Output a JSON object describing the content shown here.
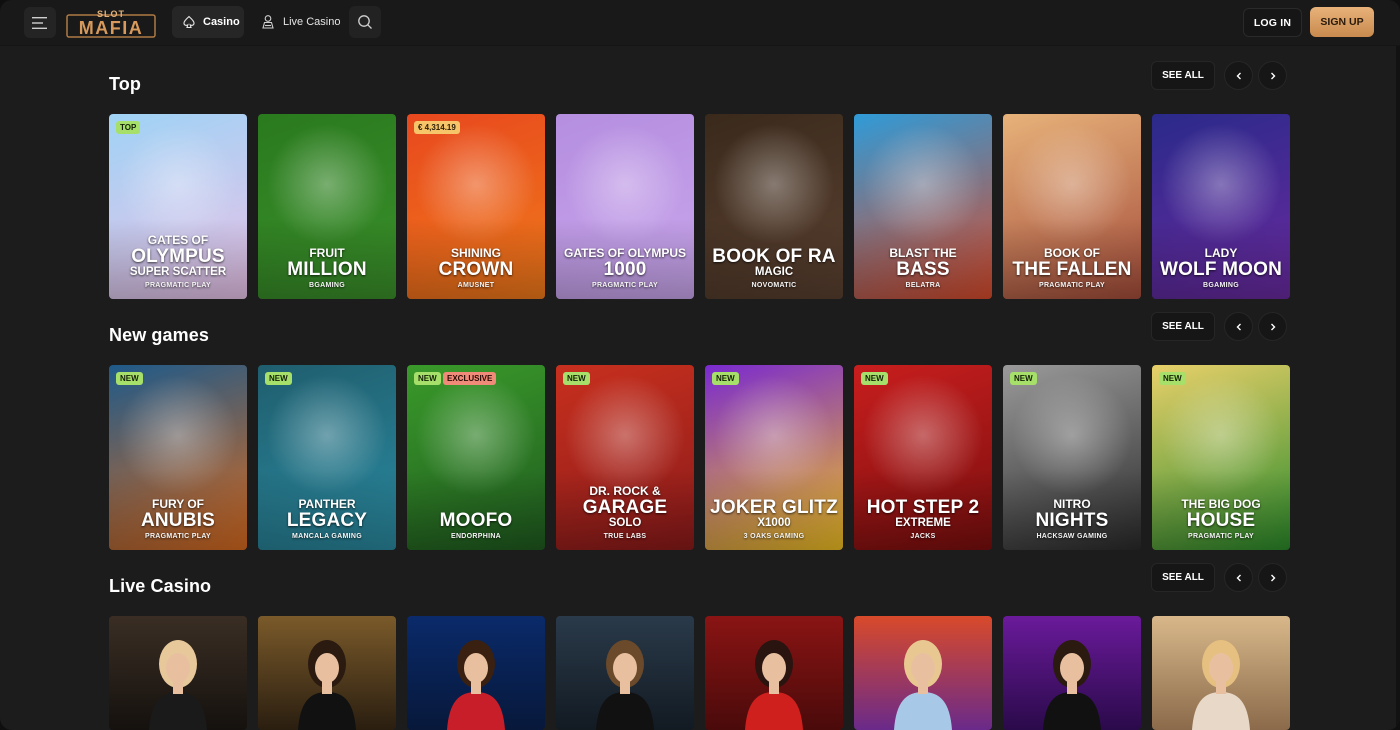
{
  "header": {
    "logo_text": "SLOT MAFIA",
    "nav_casino": "Casino",
    "nav_live": "Live Casino",
    "login_label": "LOG IN",
    "signup_label": "SIGN UP",
    "accent": "#d9a068"
  },
  "sections": [
    {
      "title": "Top",
      "see_all": "SEE ALL",
      "games": [
        {
          "l1": "GATES OF",
          "l2": "OLYMPUS",
          "l3": "SUPER SCATTER",
          "provider": "PRAGMATIC PLAY",
          "badge": "TOP",
          "bg": [
            "#9fd3f5",
            "#e9c2e8"
          ]
        },
        {
          "l1": "FRUIT",
          "l2": "MILLION",
          "l3": "",
          "provider": "BGAMING",
          "badge": "",
          "bg": [
            "#2a7a1e",
            "#3a8f2a"
          ]
        },
        {
          "l1": "SHINING",
          "l2": "CROWN",
          "l3": "",
          "provider": "AMUSNET",
          "badge": "€ 4,314.19",
          "bg": [
            "#e8481e",
            "#f07a1a"
          ]
        },
        {
          "l1": "GATES OF OLYMPUS",
          "l2": "1000",
          "l3": "",
          "provider": "PRAGMATIC PLAY",
          "badge": "",
          "bg": [
            "#b58ee0",
            "#c9a6ec"
          ]
        },
        {
          "l1": "",
          "l2": "BOOK OF RA",
          "l3": "MAGIC",
          "provider": "NOVOMATIC",
          "badge": "",
          "bg": [
            "#3a2a1c",
            "#5a4030"
          ]
        },
        {
          "l1": "BLAST THE",
          "l2": "BASS",
          "l3": "",
          "provider": "BELATRA",
          "badge": "",
          "bg": [
            "#2f9bd8",
            "#d84a2a"
          ]
        },
        {
          "l1": "BOOK OF",
          "l2": "THE FALLEN",
          "l3": "",
          "provider": "PRAGMATIC PLAY",
          "badge": "",
          "bg": [
            "#e7b27a",
            "#a44c3a"
          ]
        },
        {
          "l1": "LADY",
          "l2": "WOLF MOON",
          "l3": "",
          "provider": "BGAMING",
          "badge": "",
          "bg": [
            "#2a2a8a",
            "#6a2aa0"
          ]
        }
      ]
    },
    {
      "title": "New games",
      "see_all": "SEE ALL",
      "games": [
        {
          "l1": "FURY OF",
          "l2": "ANUBIS",
          "l3": "",
          "provider": "PRAGMATIC PLAY",
          "badge": "NEW",
          "bg": [
            "#1e5a8a",
            "#d86a1e"
          ]
        },
        {
          "l1": "PANTHER",
          "l2": "LEGACY",
          "l3": "",
          "provider": "MANCALA GAMING",
          "badge": "NEW",
          "bg": [
            "#1f5e6e",
            "#2a8aa0"
          ]
        },
        {
          "l1": "",
          "l2": "MOOFO",
          "l3": "",
          "provider": "ENDORPHINA",
          "badge": "NEW",
          "badge2": "EXCLUSIVE",
          "bg": [
            "#3a9a2a",
            "#1f5a1f"
          ]
        },
        {
          "l1": "DR. ROCK &",
          "l2": "GARAGE",
          "l3": "SOLO",
          "provider": "TRUE LABS",
          "badge": "NEW",
          "bg": [
            "#c8301e",
            "#8a1a1a"
          ]
        },
        {
          "l1": "",
          "l2": "JOKER GLITZ",
          "l3": "X1000",
          "provider": "3 OAKS GAMING",
          "badge": "NEW",
          "bg": [
            "#7a2ad0",
            "#f0c020"
          ]
        },
        {
          "l1": "",
          "l2": "HOT STEP 2",
          "l3": "EXTREME",
          "provider": "JACKS",
          "badge": "NEW",
          "bg": [
            "#c81e1e",
            "#7a0e0e"
          ]
        },
        {
          "l1": "NITRO",
          "l2": "NIGHTS",
          "l3": "",
          "provider": "HACKSAW GAMING",
          "badge": "NEW",
          "bg": [
            "#9a9a9a",
            "#2a2a2a"
          ]
        },
        {
          "l1": "THE BIG DOG",
          "l2": "HOUSE",
          "l3": "",
          "provider": "PRAGMATIC PLAY",
          "badge": "NEW",
          "bg": [
            "#e8d06a",
            "#2a8a2a"
          ]
        }
      ]
    },
    {
      "title": "Live Casino",
      "see_all": "SEE ALL",
      "tables": [
        {
          "bg": [
            "#3a2e24",
            "#15110e"
          ],
          "dress": "#1a1a1a",
          "hair": "#e6c89a"
        },
        {
          "bg": [
            "#7a5a2a",
            "#2a1e10"
          ],
          "dress": "#111111",
          "hair": "#2a1a10"
        },
        {
          "bg": [
            "#0a2a6a",
            "#07183a"
          ],
          "dress": "#c81e2a",
          "hair": "#3a2010"
        },
        {
          "bg": [
            "#2a3a4a",
            "#121a22"
          ],
          "dress": "#111111",
          "hair": "#6a4a2a"
        },
        {
          "bg": [
            "#8a1414",
            "#4a0a0a"
          ],
          "dress": "#d0201e",
          "hair": "#2a1410"
        },
        {
          "bg": [
            "#d84a2a",
            "#6a2a8a"
          ],
          "dress": "#a8c8e8",
          "hair": "#e8c890"
        },
        {
          "bg": [
            "#6a1a9a",
            "#2a0a4a"
          ],
          "dress": "#111111",
          "hair": "#2a1a10"
        },
        {
          "bg": [
            "#d8b88a",
            "#8a6a4a"
          ],
          "dress": "#e8d8c8",
          "hair": "#e6c080"
        }
      ]
    }
  ]
}
